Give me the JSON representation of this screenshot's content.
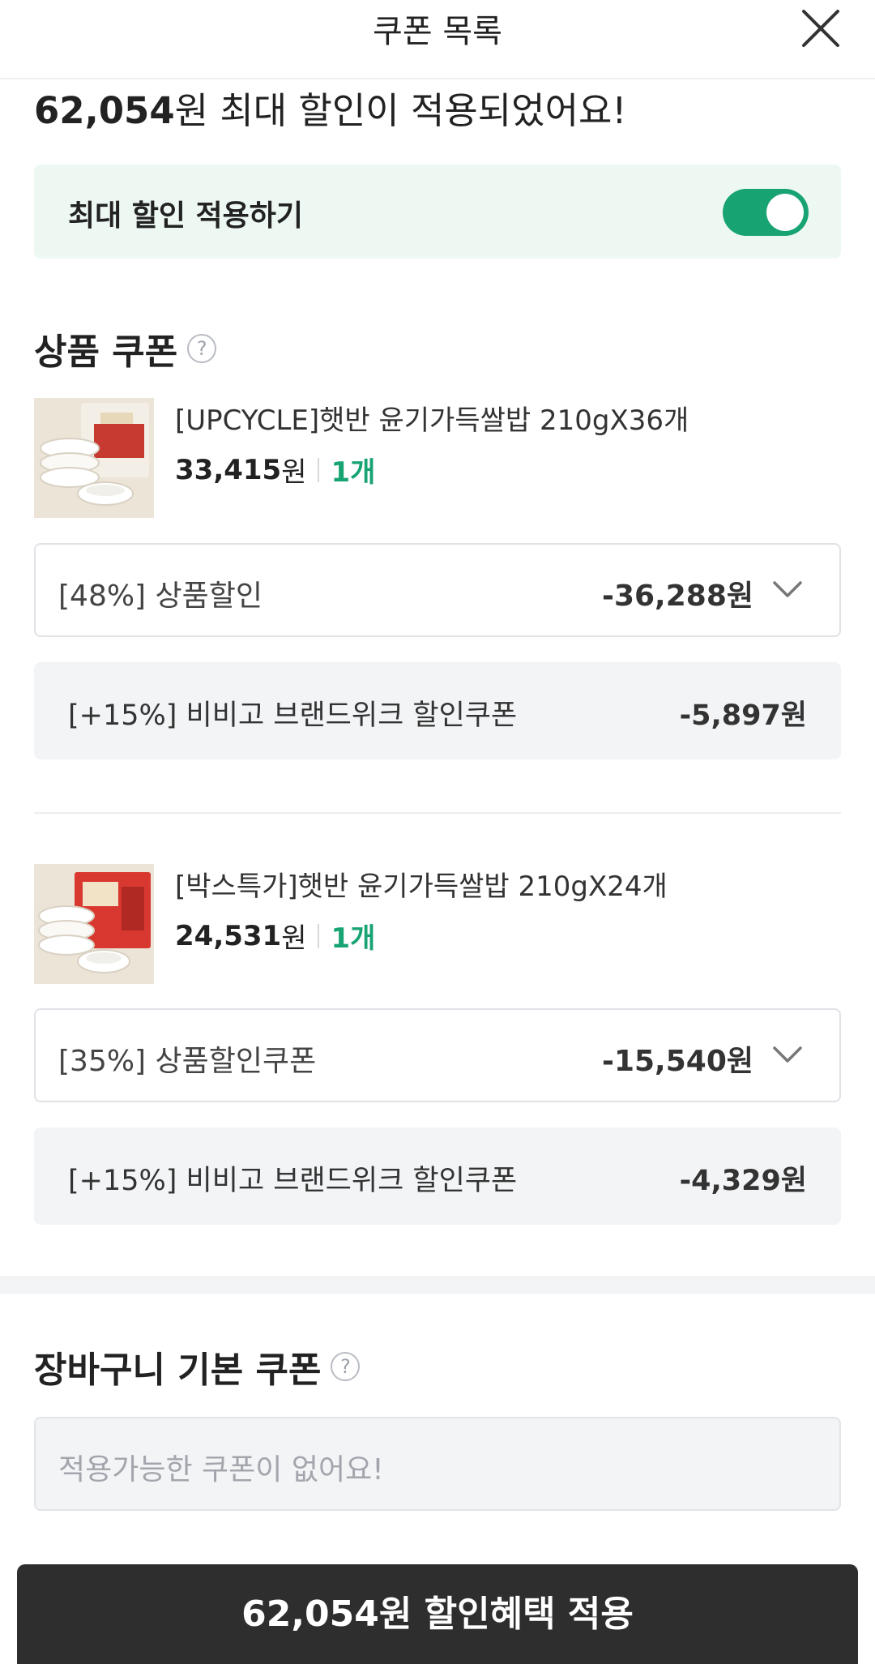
{
  "header": {
    "title": "쿠폰 목록"
  },
  "summary": {
    "amount": "62,054",
    "text": "원 최대 할인이 적용되었어요!"
  },
  "max_discount": {
    "label": "최대 할인 적용하기",
    "toggle_on": true
  },
  "product_section": {
    "title": "상품 쿠폰",
    "help": "?"
  },
  "products": [
    {
      "name": "[UPCYCLE]햇반 윤기가득쌀밥 210gX36개",
      "price": "33,415",
      "currency": "원",
      "qty": "1개",
      "coupon": {
        "label": "[48%] 상품할인",
        "value": "-36,288원"
      },
      "extra": {
        "label": "[+15%] 비비고 브랜드위크 할인쿠폰",
        "value": "-5,897원"
      }
    },
    {
      "name": "[박스특가]햇반 윤기가득쌀밥 210gX24개",
      "price": "24,531",
      "currency": "원",
      "qty": "1개",
      "coupon": {
        "label": "[35%] 상품할인쿠폰",
        "value": "-15,540원"
      },
      "extra": {
        "label": "[+15%] 비비고 브랜드위크 할인쿠폰",
        "value": "-4,329원"
      }
    }
  ],
  "cart_section": {
    "title": "장바구니 기본 쿠폰",
    "help": "?",
    "empty_text": "적용가능한 쿠폰이 없어요!"
  },
  "apply_button": {
    "label": "62,054원 할인혜택 적용"
  },
  "colors": {
    "accent": "#18a373",
    "mint_bg": "#edf8f3",
    "button_bg": "#2e2e2e"
  }
}
